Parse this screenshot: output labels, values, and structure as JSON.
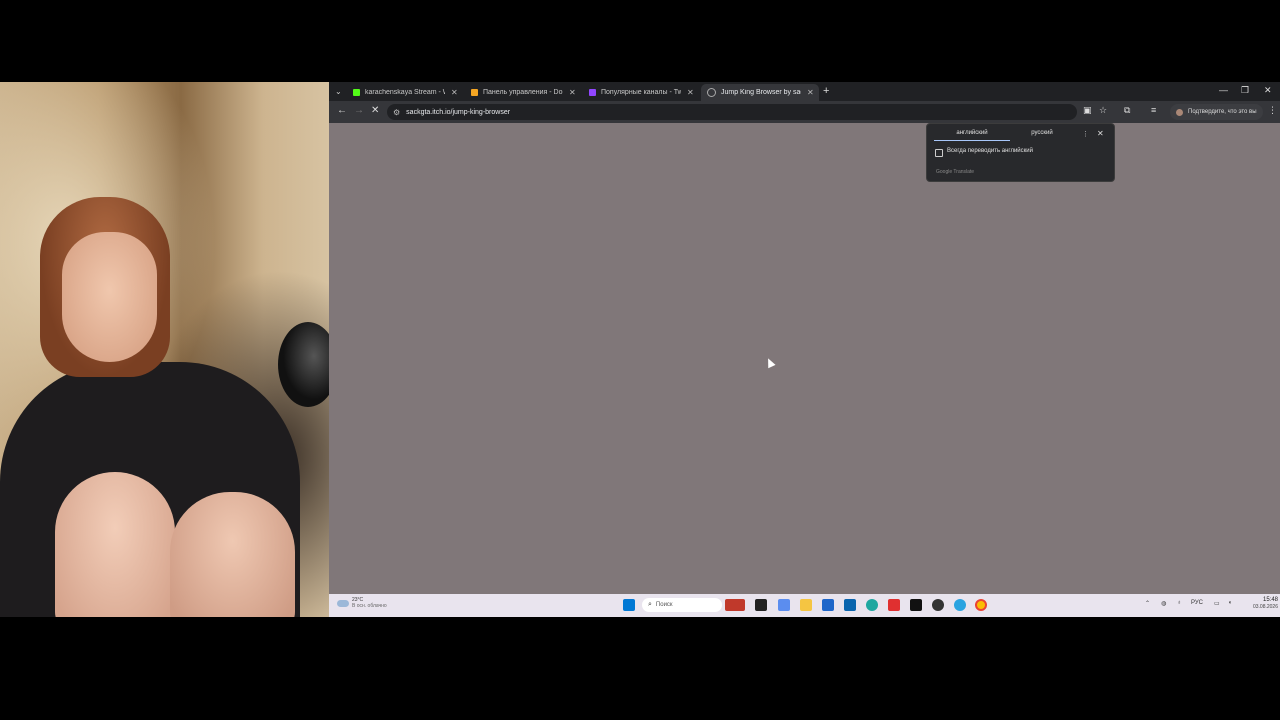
{
  "tabs": [
    {
      "label": "karachenskaya Stream - Watch",
      "favicon_color": "#53fc18"
    },
    {
      "label": "Панель управления - Donatio",
      "favicon_color": "#f5a623"
    },
    {
      "label": "Популярные каналы - Twitch",
      "favicon_color": "#9146ff"
    },
    {
      "label": "Jump King Browser by sack",
      "favicon_color": "#aaaaaa"
    }
  ],
  "address_bar": {
    "url": "sackgta.itch.io/jump-king-browser"
  },
  "profile": {
    "label": "Подтвердите, что это вы"
  },
  "translate_popup": {
    "source_lang": "английский",
    "target_lang": "русский",
    "always_translate": "Всегда переводить английский",
    "brand": "Google Translate"
  },
  "page": {
    "background": "#807779"
  },
  "taskbar": {
    "weather_temp": "23°C",
    "weather_desc": "В осн. облачно",
    "search_placeholder": "Поиск",
    "language": "РУС",
    "time": "15:48",
    "date": "03.08.2026"
  }
}
